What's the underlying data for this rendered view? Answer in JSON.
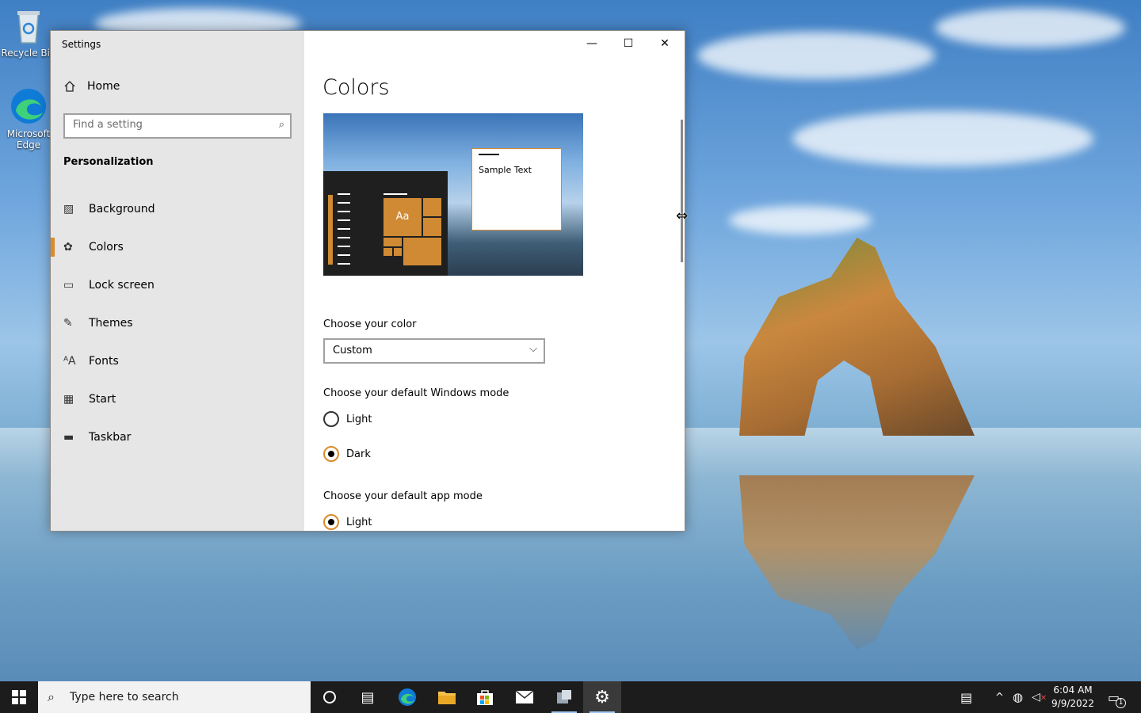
{
  "desktop": {
    "icons": [
      {
        "label": "Recycle Bin"
      },
      {
        "label": "Microsoft Edge"
      }
    ]
  },
  "window": {
    "title": "Settings",
    "controls": {
      "minimize": "—",
      "maximize": "☐",
      "close": "✕"
    }
  },
  "nav": {
    "home_label": "Home",
    "search_placeholder": "Find a setting",
    "section_title": "Personalization",
    "items": [
      {
        "label": "Background",
        "icon": "image-icon"
      },
      {
        "label": "Colors",
        "icon": "palette-icon"
      },
      {
        "label": "Lock screen",
        "icon": "lock-screen-icon"
      },
      {
        "label": "Themes",
        "icon": "themes-icon"
      },
      {
        "label": "Fonts",
        "icon": "fonts-icon"
      },
      {
        "label": "Start",
        "icon": "start-icon"
      },
      {
        "label": "Taskbar",
        "icon": "taskbar-icon"
      }
    ],
    "active_item": "Colors"
  },
  "content": {
    "title": "Colors",
    "preview": {
      "sample_text": "Sample Text",
      "tile_label": "Aa",
      "accent": "#d08a34"
    },
    "choose_color_label": "Choose your color",
    "color_select_value": "Custom",
    "windows_mode_label": "Choose your default Windows mode",
    "windows_mode_options": [
      {
        "label": "Light",
        "selected": false
      },
      {
        "label": "Dark",
        "selected": true
      }
    ],
    "app_mode_label": "Choose your default app mode",
    "app_mode_options": [
      {
        "label": "Light",
        "selected": true
      }
    ]
  },
  "taskbar": {
    "search_placeholder": "Type here to search",
    "time": "6:04 AM",
    "date": "9/9/2022",
    "notification_count": "1"
  },
  "colors": {
    "accent": "#d98c2b",
    "taskbar_bg": "#1c1c1c",
    "nav_bg": "#e6e6e6"
  }
}
